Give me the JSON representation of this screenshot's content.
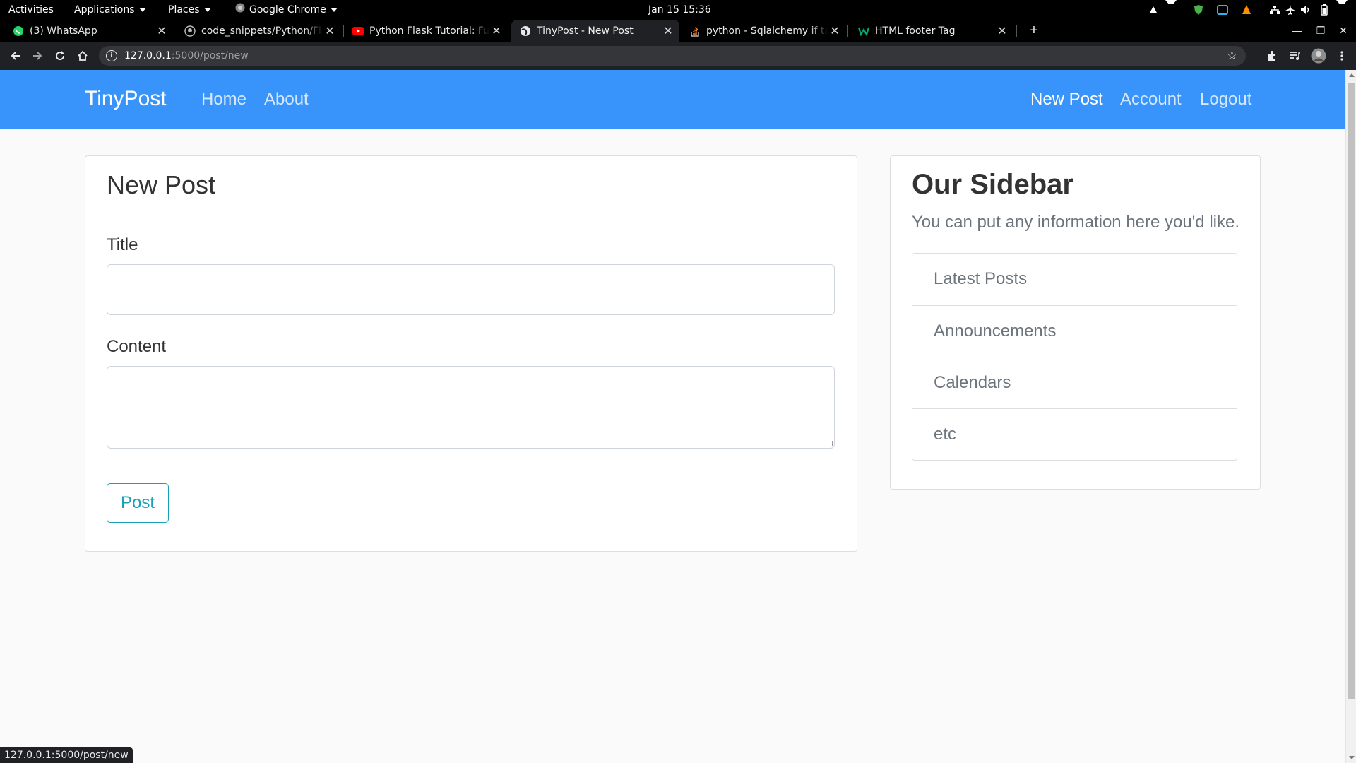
{
  "system": {
    "activities": "Activities",
    "applications": "Applications",
    "places": "Places",
    "app_name": "Google Chrome",
    "clock": "Jan 15  15:36"
  },
  "tabs": [
    {
      "title": "(3) WhatsApp",
      "icon": "whatsapp-icon"
    },
    {
      "title": "code_snippets/Python/Fl",
      "icon": "github-icon"
    },
    {
      "title": "Python Flask Tutorial: Ful",
      "icon": "youtube-icon"
    },
    {
      "title": "TinyPost - New Post",
      "icon": "globe-icon",
      "active": true
    },
    {
      "title": "python - Sqlalchemy if tab",
      "icon": "stackoverflow-icon"
    },
    {
      "title": "HTML footer Tag",
      "icon": "w3schools-icon"
    }
  ],
  "address": {
    "host": "127.0.0.1",
    "path": ":5000/post/new"
  },
  "site": {
    "brand": "TinyPost",
    "nav_left": [
      "Home",
      "About"
    ],
    "nav_right": [
      "New Post",
      "Account",
      "Logout"
    ],
    "brand_color": "#3894fa"
  },
  "form": {
    "legend": "New Post",
    "title_label": "Title",
    "title_value": "",
    "content_label": "Content",
    "content_value": "",
    "submit_label": "Post",
    "accent_color": "#17a2b8"
  },
  "sidebar": {
    "heading": "Our Sidebar",
    "text": "You can put any information here you'd like.",
    "items": [
      "Latest Posts",
      "Announcements",
      "Calendars",
      "etc"
    ]
  },
  "status_bar": {
    "url": "127.0.0.1:5000/post/new"
  }
}
